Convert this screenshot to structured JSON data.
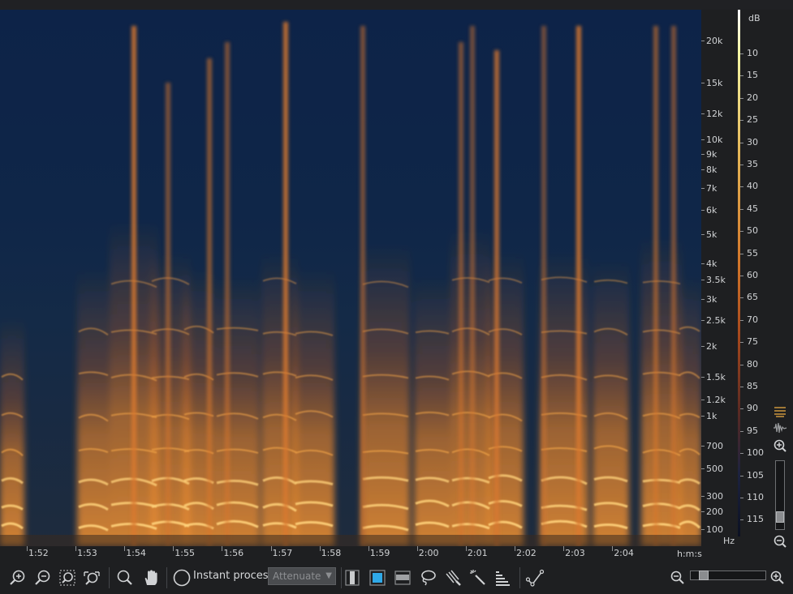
{
  "frequency_axis": {
    "unit": "Hz",
    "labels": [
      "20k",
      "15k",
      "12k",
      "10k",
      "9k",
      "8k",
      "7k",
      "6k",
      "5k",
      "4k",
      "3.5k",
      "3k",
      "2.5k",
      "2k",
      "1.5k",
      "1.2k",
      "1k",
      "700",
      "500",
      "300",
      "200",
      "100"
    ]
  },
  "db_scale": {
    "unit": "dB",
    "labels": [
      "10",
      "15",
      "20",
      "25",
      "30",
      "35",
      "40",
      "45",
      "50",
      "55",
      "60",
      "65",
      "70",
      "75",
      "80",
      "85",
      "90",
      "95",
      "100",
      "105",
      "110",
      "115"
    ]
  },
  "time_axis": {
    "unit": "h:m:s",
    "labels": [
      "1:52",
      "1:53",
      "1:54",
      "1:55",
      "1:56",
      "1:57",
      "1:58",
      "1:59",
      "2:00",
      "2:01",
      "2:02",
      "2:03",
      "2:04"
    ]
  },
  "toolbar": {
    "instant_process_label": "Instant process",
    "mode_value": "Attenuate"
  },
  "colors": {
    "spectrogram_low": "#0f2648",
    "spectrogram_mid": "#d2762a",
    "spectrogram_high": "#ffe08a",
    "selection_active": "#2fa9e8"
  },
  "icons": {
    "zoom_in": "zoom-in-icon",
    "zoom_out": "zoom-out-icon",
    "zoom_selection": "zoom-selection-icon",
    "zoom_fit": "zoom-fit-icon",
    "magnify": "magnify-icon",
    "hand": "hand-icon",
    "time_selection": "time-selection-icon",
    "time_frequency_selection": "time-frequency-selection-icon",
    "frequency_selection": "frequency-selection-icon",
    "lasso": "lasso-icon",
    "brush": "brush-icon",
    "magic_wand": "magic-wand-icon",
    "harmonics": "harmonics-icon",
    "waveform_toggle": "waveform-icon",
    "spectrogram_toggle": "spectrogram-icon",
    "check_path": "check-path-icon"
  }
}
